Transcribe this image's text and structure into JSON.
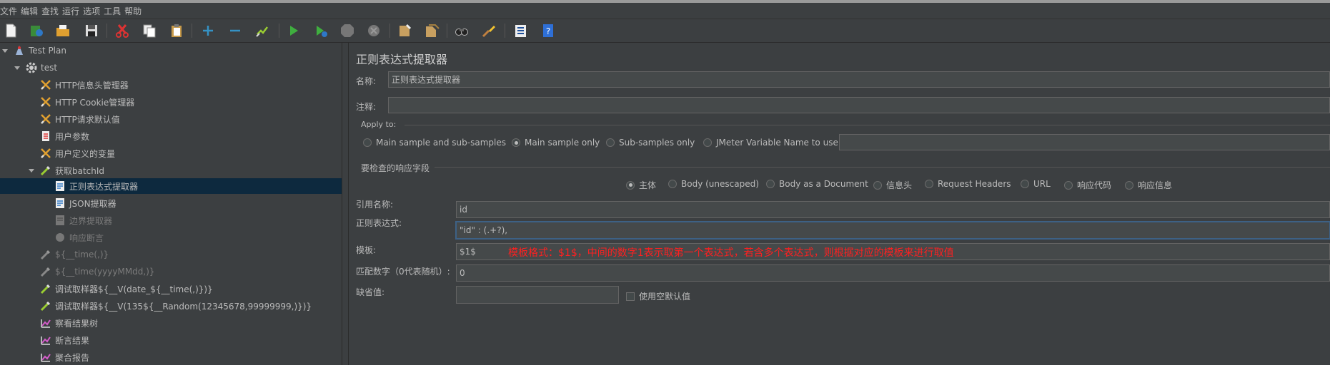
{
  "menu": [
    "文件",
    "编辑",
    "查找",
    "运行",
    "选项",
    "工具",
    "帮助"
  ],
  "toolbar": {
    "icons": [
      "new-icon",
      "templates-icon",
      "open-icon",
      "save-icon",
      "cut-icon",
      "copy-icon",
      "paste-icon",
      "expand-icon",
      "collapse-icon",
      "toggle-icon",
      "start-icon",
      "start-no-pause-icon",
      "stop-icon",
      "shutdown-icon",
      "clear-icon",
      "clear-all-icon",
      "search-icon",
      "reset-search-icon",
      "function-helper-icon",
      "help-icon"
    ]
  },
  "tree": {
    "nodes": [
      {
        "label": "Test Plan",
        "icon": "test-plan-icon",
        "level": 0,
        "expanded": true,
        "disabled": false
      },
      {
        "label": "test",
        "icon": "thread-group-gear-icon",
        "level": 1,
        "expanded": true,
        "disabled": false
      },
      {
        "label": "HTTP信息头管理器",
        "icon": "config-tools-icon",
        "level": 2,
        "disabled": false
      },
      {
        "label": "HTTP Cookie管理器",
        "icon": "config-tools-icon",
        "level": 2,
        "disabled": false
      },
      {
        "label": "HTTP请求默认值",
        "icon": "config-tools-icon",
        "level": 2,
        "disabled": false
      },
      {
        "label": "用户参数",
        "icon": "preprocessor-icon",
        "level": 2,
        "disabled": false
      },
      {
        "label": "用户定义的变量",
        "icon": "config-tools-icon",
        "level": 2,
        "disabled": false
      },
      {
        "label": "获取batchId",
        "icon": "sampler-pipette-icon",
        "level": 2,
        "expanded": true,
        "disabled": false
      },
      {
        "label": "正则表达式提取器",
        "icon": "extractor-icon",
        "level": 3,
        "disabled": false,
        "selected": true
      },
      {
        "label": "JSON提取器",
        "icon": "extractor-icon",
        "level": 3,
        "disabled": false
      },
      {
        "label": "边界提取器",
        "icon": "extractor-icon",
        "level": 3,
        "disabled": true
      },
      {
        "label": "响应断言",
        "icon": "assertion-icon",
        "level": 3,
        "disabled": true
      },
      {
        "label": "${__time(,)}",
        "icon": "sampler-pipette-icon",
        "level": 2,
        "disabled": true
      },
      {
        "label": "${__time(yyyyMMdd,)}",
        "icon": "sampler-pipette-icon",
        "level": 2,
        "disabled": true
      },
      {
        "label": "调试取样器${__V(date_${__time(,)})}",
        "icon": "sampler-pipette-icon",
        "level": 2,
        "disabled": false
      },
      {
        "label": "调试取样器${__V(135${__Random(12345678,99999999,)})}",
        "icon": "sampler-pipette-icon",
        "level": 2,
        "disabled": false
      },
      {
        "label": "察看结果树",
        "icon": "listener-icon",
        "level": 2,
        "disabled": false
      },
      {
        "label": "断言结果",
        "icon": "listener-icon",
        "level": 2,
        "disabled": false
      },
      {
        "label": "聚合报告",
        "icon": "listener-icon",
        "level": 2,
        "disabled": false
      }
    ]
  },
  "panel": {
    "title": "正则表达式提取器",
    "name_label": "名称:",
    "name_value": "正则表达式提取器",
    "comment_label": "注释:",
    "comment_value": "",
    "apply_to": {
      "label": "Apply to:",
      "options": [
        "Main sample and sub-samples",
        "Main sample only",
        "Sub-samples only",
        "JMeter Variable Name to use"
      ],
      "selected": 1,
      "var_value": ""
    },
    "field_check": {
      "label": "要检查的响应字段",
      "options": [
        "主体",
        "Body (unescaped)",
        "Body as a Document",
        "信息头",
        "Request Headers",
        "URL",
        "响应代码",
        "响应信息"
      ],
      "selected": 0
    },
    "ref_name_label": "引用名称:",
    "ref_name_value": "id",
    "regex_label": "正则表达式:",
    "regex_value": "\"id\" : (.+?),",
    "template_label": "模板:",
    "template_value": "$1$",
    "annotation": "模板格式：$1$，中间的数字1表示取第一个表达式，若含多个表达式，则根据对应的模板来进行取值",
    "match_label": "匹配数字（0代表随机）:",
    "match_value": "0",
    "default_label": "缺省值:",
    "default_value": "",
    "use_empty_label": "使用空默认值"
  },
  "colors": {
    "bg": "#3c3f41",
    "selection": "#0d293e",
    "annotation": "#ff2020"
  }
}
